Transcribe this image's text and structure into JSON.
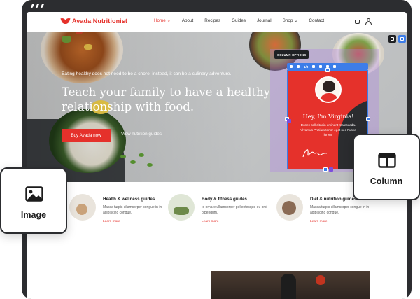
{
  "app": {
    "brand_name": "Avada Nutritionist",
    "brand_color": "#e5312b"
  },
  "nav": {
    "items": [
      {
        "label": "Home ⌄",
        "active": true
      },
      {
        "label": "About"
      },
      {
        "label": "Recipes"
      },
      {
        "label": "Guides"
      },
      {
        "label": "Journal"
      },
      {
        "label": "Shop ⌄"
      },
      {
        "label": "Contact"
      }
    ],
    "icons": [
      "cart-icon",
      "user-icon"
    ]
  },
  "hero": {
    "tagline": "Eating healthy does not need to be a chore, instead, it can be a culinary adventure.",
    "title": "Teach your family to have a healthy relationship with food.",
    "primary_button": "Buy Avada now",
    "secondary_link": "View nutrition guides"
  },
  "editor": {
    "column_options_label": "COLUMN OPTIONS",
    "toolbar_count": "1/3",
    "accent_color": "#3d7de8",
    "highlight_color": "#b184e5",
    "controls": [
      "pencil-icon",
      "layout-icon"
    ]
  },
  "profile_card": {
    "title": "Hey, I'm Virginia!",
    "text": "Donec sollicitudin eminent malesuada. Vivamus Pretium tortor eget nec Fusce lorem."
  },
  "features": [
    {
      "title": "Health & wellness guides",
      "text": "Massa turpis ullamcorper congue in in adipiscing congue.",
      "link": "Learn more"
    },
    {
      "title": "Body & fitness guides",
      "text": "Id ornare ullamcorper pellentesque eu orci bibendum.",
      "link": "Learn more"
    },
    {
      "title": "Diet & nutrition guides",
      "text": "Massa turpis ullamcorper congue in in adipiscing congue.",
      "link": "Learn more"
    }
  ],
  "badges": {
    "image_label": "Image",
    "column_label": "Column"
  }
}
